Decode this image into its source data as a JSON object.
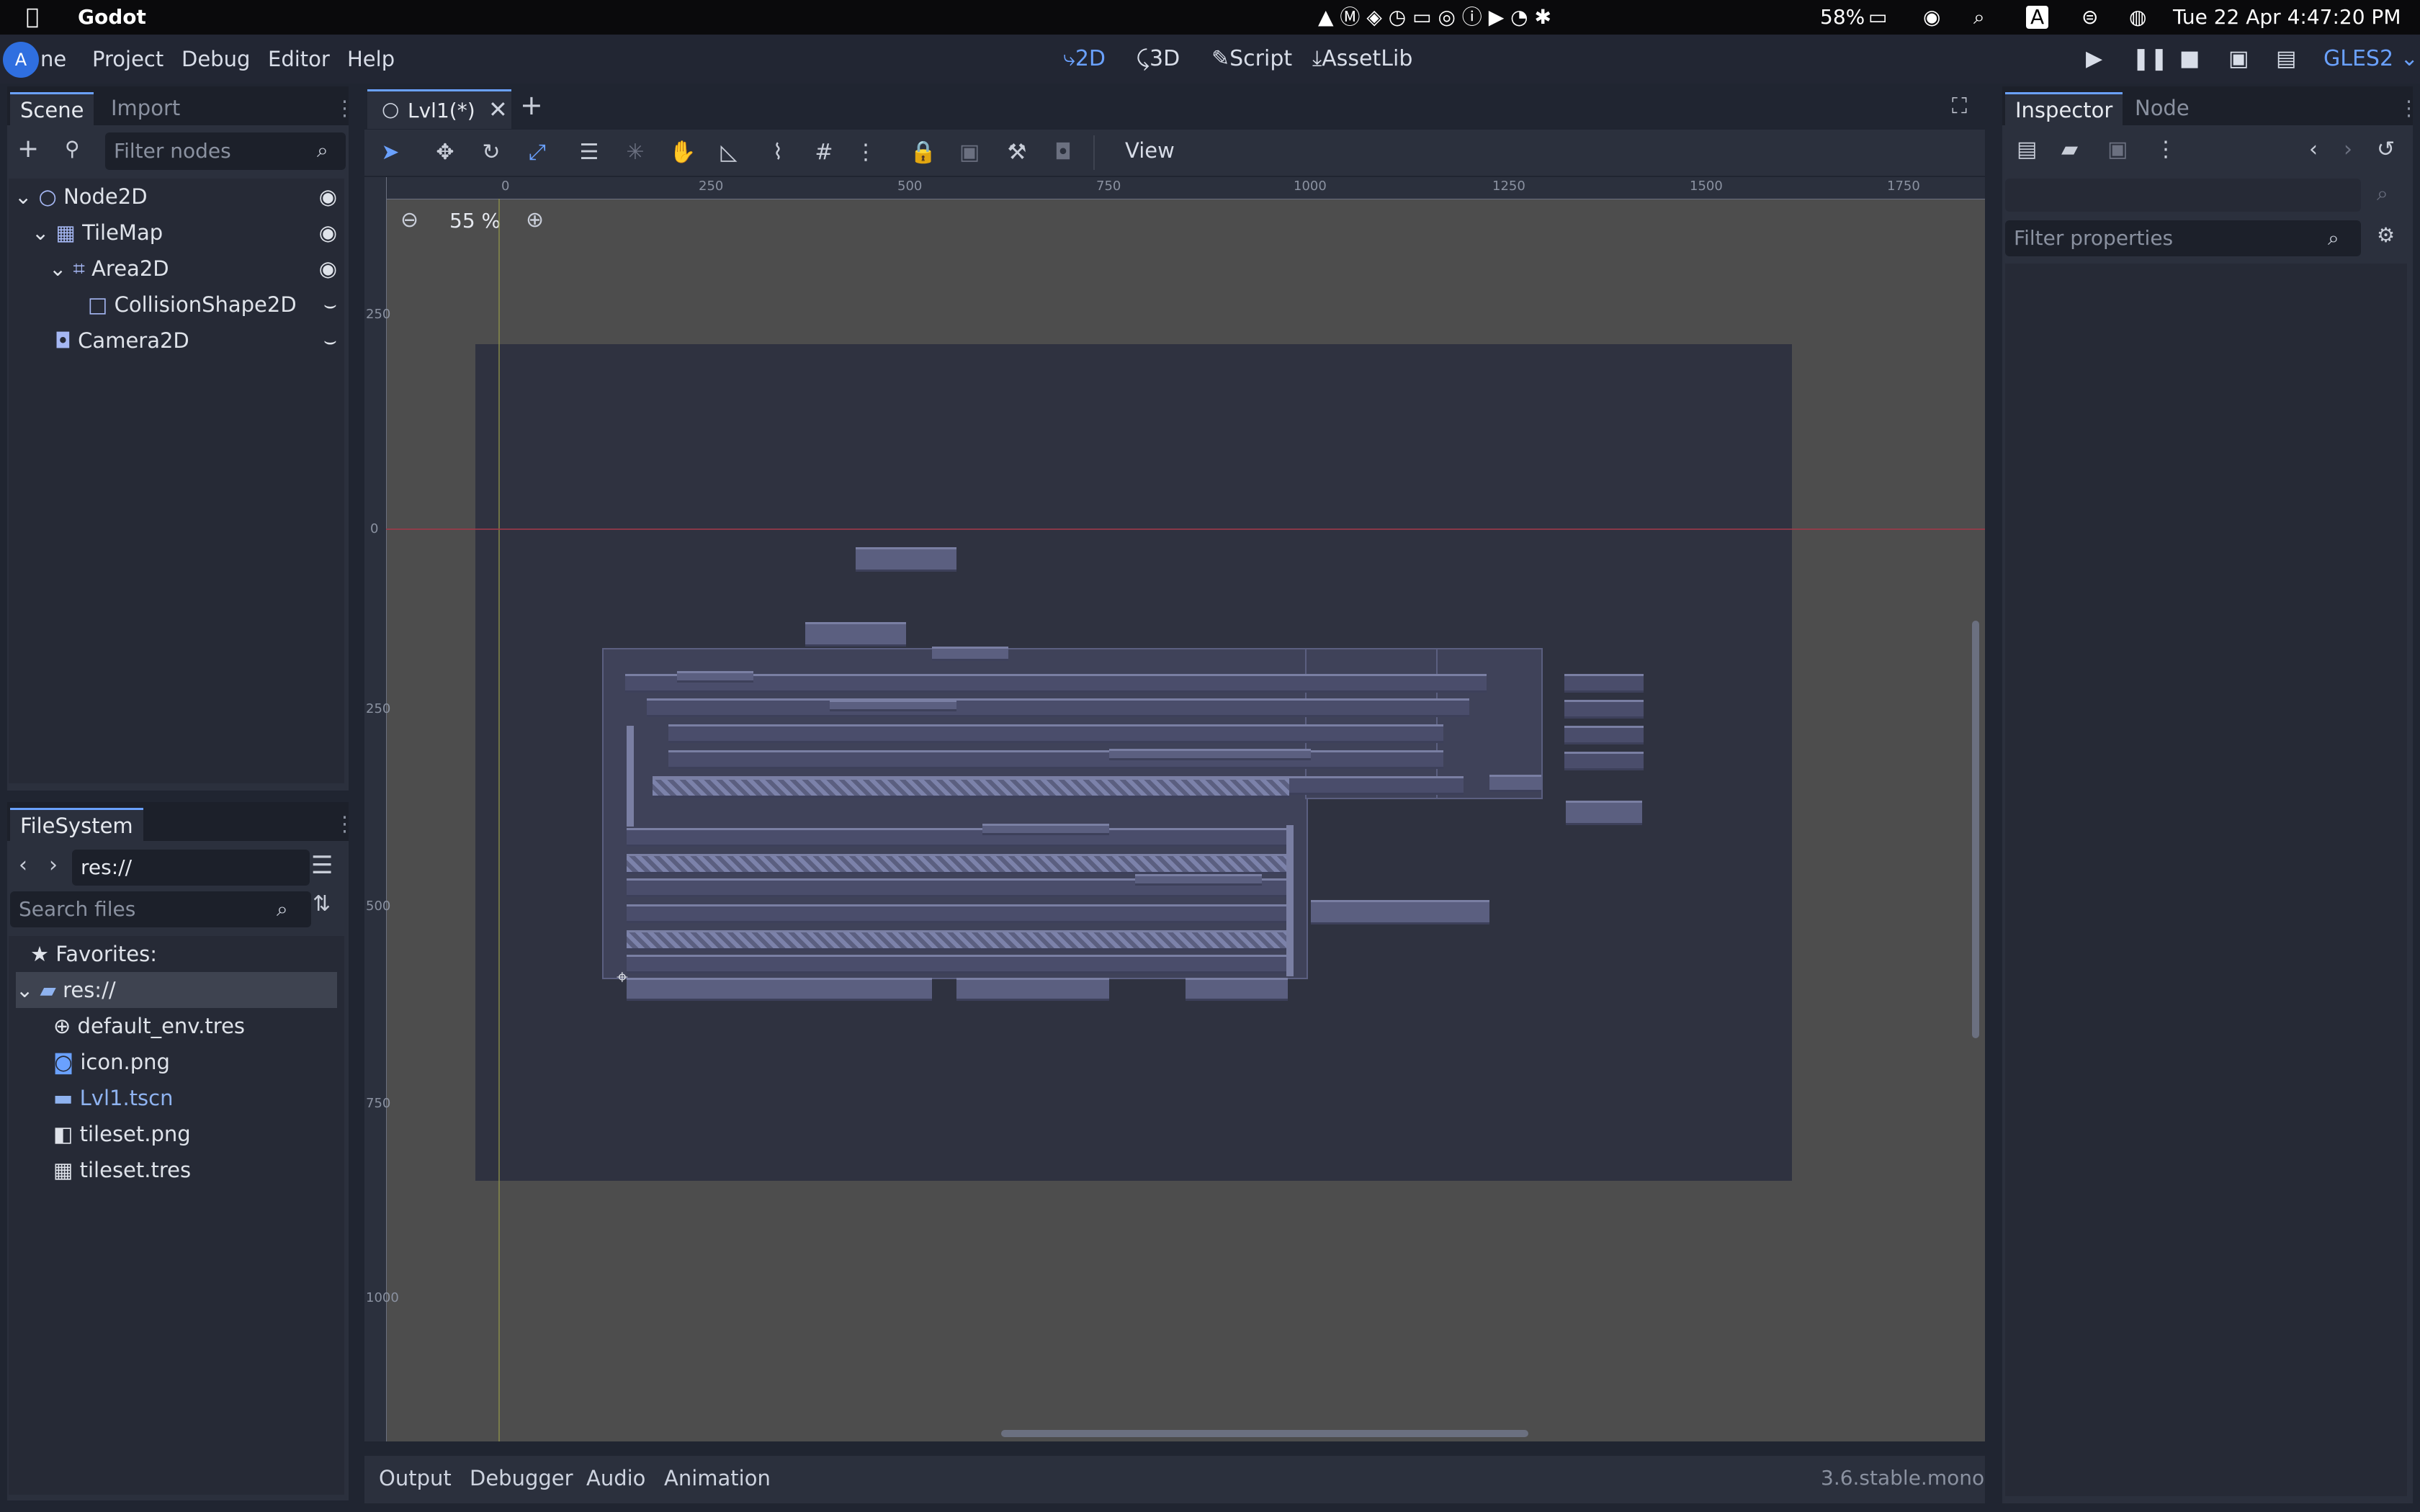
{
  "macbar": {
    "app_name": "Godot",
    "battery": "58%",
    "datetime": "Tue 22 Apr  4:47:20 PM",
    "input_source": "A"
  },
  "menus": {
    "scene": "ne",
    "avatar": "A",
    "items": [
      "Project",
      "Debug",
      "Editor",
      "Help"
    ]
  },
  "workspaces": [
    "2D",
    "3D",
    "Script",
    "AssetLib"
  ],
  "renderer": "GLES2",
  "scene_dock": {
    "tabs": [
      "Scene",
      "Import"
    ],
    "filter_placeholder": "Filter nodes",
    "nodes": [
      "Node2D",
      "TileMap",
      "Area2D",
      "CollisionShape2D",
      "Camera2D"
    ]
  },
  "filesystem": {
    "tab": "FileSystem",
    "path": "res://",
    "search_placeholder": "Search files",
    "favorites_label": "Favorites:",
    "root": "res://",
    "files": [
      "default_env.tres",
      "icon.png",
      "Lvl1.tscn",
      "tileset.png",
      "tileset.tres"
    ]
  },
  "editor": {
    "scene_tab": "Lvl1(*)",
    "view_menu": "View",
    "zoom": "55 %",
    "ruler_h": [
      "0",
      "250",
      "500",
      "750",
      "1000",
      "1250",
      "1500",
      "1750"
    ],
    "ruler_v": [
      "250",
      "0",
      "250",
      "500",
      "750",
      "1000"
    ]
  },
  "bottom_tabs": [
    "Output",
    "Debugger",
    "Audio",
    "Animation"
  ],
  "version": "3.6.stable.mono",
  "inspector": {
    "tabs": [
      "Inspector",
      "Node"
    ],
    "filter_placeholder": "Filter properties"
  },
  "colors": {
    "accent": "#6aa1ff",
    "panel": "#2b303d",
    "background": "#202531",
    "canvas": "#4d4d4d",
    "camera_rect": "#2f3240",
    "tile": "#5b5f80"
  }
}
